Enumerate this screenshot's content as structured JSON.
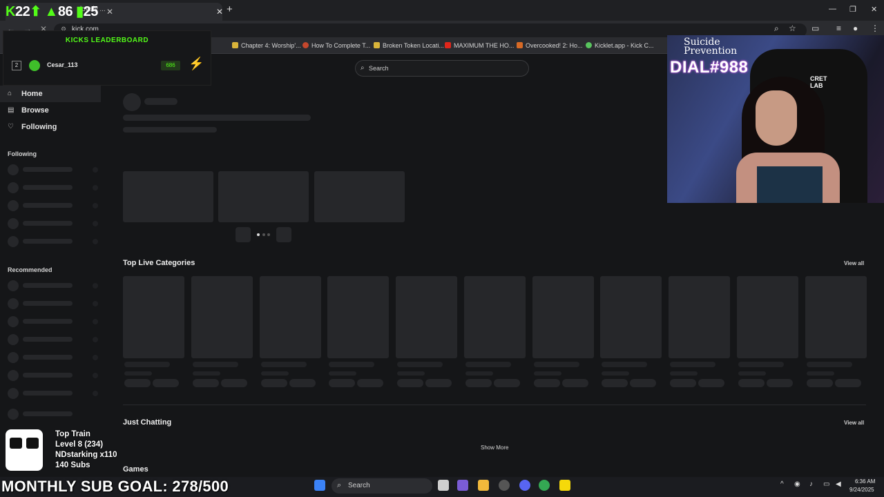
{
  "browser": {
    "tab_title": "lovely ...",
    "url": "kick.com",
    "bookmarks": [
      "Chapter 4: Worship'...",
      "How To Complete T...",
      "Broken Token Locati...",
      "MAXIMUM THE HO...",
      "Overcooked! 2: Ho...",
      "Kicklet.app - Kick C..."
    ]
  },
  "stream_overlay": {
    "kick_count": "22",
    "up_count": "86",
    "viewer_count": "25",
    "leaderboard_title": "KICKS LEADERBOARD",
    "rank": "2",
    "user": "Cesar_113",
    "kicks": "686",
    "cam_line1": "Suicide",
    "cam_line2": "Prevention",
    "cam_line3": "DIAL#988",
    "cam_brand": "CRET\nLAB",
    "train_title": "Top Train",
    "train_level": "Level 8  (234)",
    "train_user": "NDstarking x110",
    "train_subs": "140 Subs",
    "sub_goal": "MONTHLY SUB GOAL: 278/500"
  },
  "search": {
    "placeholder": "Search"
  },
  "sidebar": {
    "home": "Home",
    "browse": "Browse",
    "following": "Following",
    "following_header": "Following",
    "recommended_header": "Recommended"
  },
  "sections": {
    "top_live_categories": "Top Live Categories",
    "just_chatting": "Just Chatting",
    "games": "Games",
    "view_all": "View all",
    "show_more": "Show More"
  },
  "taskbar": {
    "search_label": "Search",
    "time": "6:36 AM",
    "date": "9/24/2025"
  }
}
